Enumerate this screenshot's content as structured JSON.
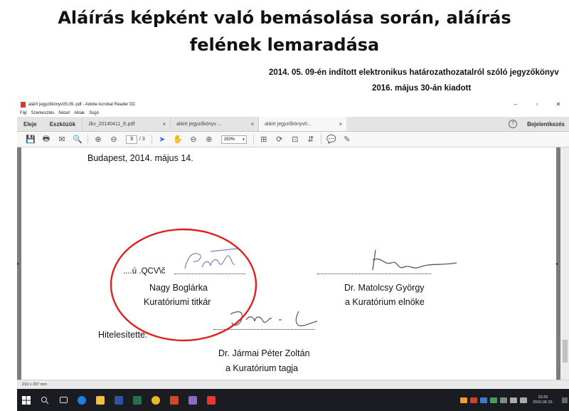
{
  "slide": {
    "title_line1": "Aláírás képként való bemásolása során, aláírás",
    "title_line2": "felének lemaradása",
    "subtitle_line1": "2014. 05. 09-én indított elektronikus határozathozatalról szóló jegyzőkönyv",
    "subtitle_line2": "2016. május 30-án kiadott"
  },
  "window": {
    "title": "aláírt jegyzőkönyv05.09..pdf - Adobe Acrobat Reader DC",
    "controls": [
      "–",
      "▫",
      "✕"
    ]
  },
  "menu": [
    "Fájl",
    "Szerkesztés",
    "Nézet",
    "Ablak",
    "Súgó"
  ],
  "tabs": {
    "home": "Eleje",
    "tools": "Eszközök",
    "documents": [
      {
        "label": "Jkv_20140411_E.pdf",
        "active": false
      },
      {
        "label": "aláírt jegyzőkönyv ...",
        "active": false
      },
      {
        "label": "aláírt jegyzőkönyv0...",
        "active": true
      }
    ],
    "close_symbol": "×",
    "help": "?",
    "login": "Bejelentkezés"
  },
  "toolbar": {
    "page_current": "3",
    "page_total": "/ 3",
    "zoom": "150%",
    "zoom_arrow": "▾",
    "icons": {
      "save": "💾",
      "print": "🖶",
      "email": "✉",
      "search": "🔍",
      "page_up": "⊕",
      "page_down": "⊖",
      "select": "➤",
      "hand": "✋",
      "zoom_out": "⊖",
      "zoom_in": "⊕",
      "fit": "⊞",
      "rotate": "⟳",
      "fullscreen": "⊡",
      "scroll": "⇵",
      "comment": "💬",
      "sign": "✎"
    }
  },
  "document": {
    "place_date": "Budapest, 2014. május 14.",
    "garbled_text": "....ú .QCV\\č",
    "signer1_name": "Nagy Boglárka",
    "signer1_role": "Kuratóriumi titkár",
    "signer2_name": "Dr. Matolcsy György",
    "signer2_role": "a Kuratórium elnöke",
    "certified_label": "Hitelesítette:",
    "signer3_name": "Dr. Jármai Péter Zoltán",
    "signer3_role": "a Kuratórium tagja",
    "signature1_text": "Boglárka",
    "page_arrow_left": "▸",
    "page_arrow_right": "◂"
  },
  "status": {
    "page_size": "210 x 297 mm"
  },
  "taskbar": {
    "time": "23:26",
    "date": "2016.06.15."
  },
  "colors": {
    "annotation_red": "#e0201c",
    "signature_blue": "#7f7fc9",
    "taskbar": "#1a1c22",
    "accent": "#2b78d6"
  }
}
